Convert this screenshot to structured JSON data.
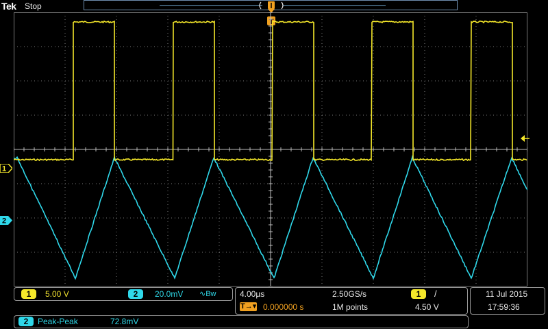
{
  "header": {
    "brand": "Tek",
    "status": "Stop"
  },
  "colors": {
    "ch1": "#f5e82a",
    "ch2": "#2fd8ea",
    "grid": "#7a7a7a",
    "trigger": "#f0a020"
  },
  "markers": {
    "ch1_label": "1",
    "ch2_label": "2",
    "trigger_label": "T"
  },
  "ch1_panel": {
    "number": "1",
    "scale": "5.00 V"
  },
  "ch2_panel": {
    "number": "2",
    "scale": "20.0mV",
    "bw_icon": "∿Bw"
  },
  "timebase": {
    "scale": "4.00µs",
    "sample_rate": "2.50GS/s",
    "delay_icon": "T→▾",
    "delay": "0.000000 s",
    "record_length": "1M points"
  },
  "trigger_panel": {
    "source": "1",
    "slope": "/",
    "level": "4.50 V"
  },
  "datetime": {
    "date": "11 Jul  2015",
    "time": "17:59:36"
  },
  "measurement": {
    "channel": "2",
    "type": "Peak-Peak",
    "value": "72.8mV"
  }
}
